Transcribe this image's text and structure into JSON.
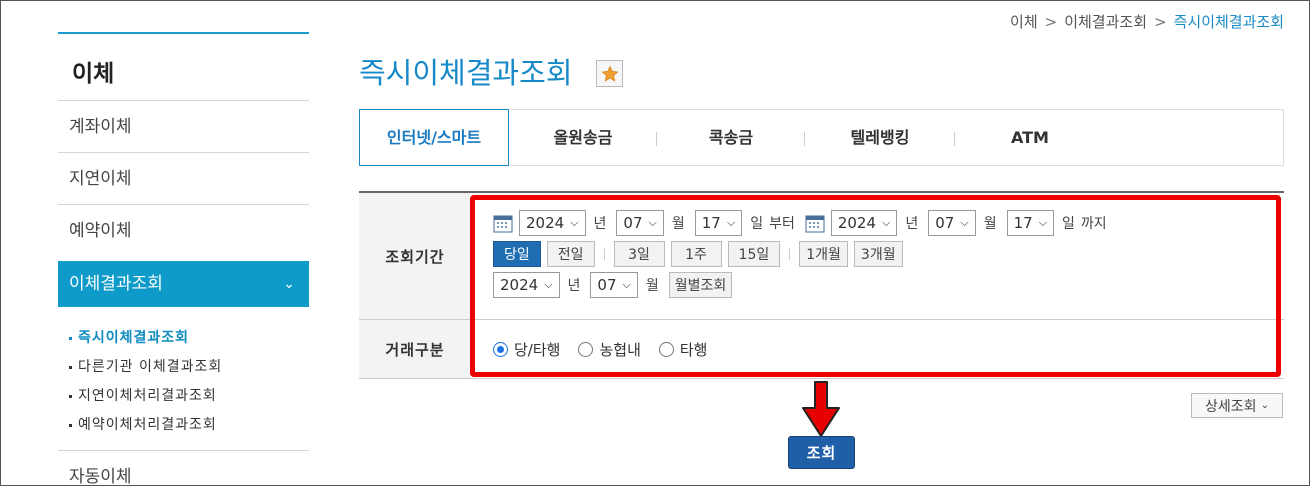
{
  "breadcrumb": [
    "이체",
    "이체결과조회",
    "즉시이체결과조회"
  ],
  "breadcrumb_sep": ">",
  "sidebar": {
    "title": "이체",
    "items": [
      {
        "label": "계좌이체"
      },
      {
        "label": "지연이체"
      },
      {
        "label": "예약이체"
      },
      {
        "label": "이체결과조회",
        "active": true
      }
    ],
    "subitems": [
      {
        "label": "즉시이체결과조회",
        "active": true
      },
      {
        "label": "다른기관 이체결과조회"
      },
      {
        "label": "지연이체처리결과조회"
      },
      {
        "label": "예약이체처리결과조회"
      }
    ],
    "last_item": "자동이체"
  },
  "page_title": "즉시이체결과조회",
  "tabs": [
    {
      "label": "인터넷/스마트",
      "active": true
    },
    {
      "label": "올원송금"
    },
    {
      "label": "콕송금"
    },
    {
      "label": "텔레뱅킹"
    },
    {
      "label": "ATM"
    }
  ],
  "period": {
    "label": "조회기간",
    "from": {
      "year": "2024",
      "month": "07",
      "day": "17"
    },
    "to": {
      "year": "2024",
      "month": "07",
      "day": "17"
    },
    "unit_year": "년",
    "unit_month": "월",
    "unit_day": "일",
    "from_suffix": "부터",
    "to_suffix": "까지",
    "quick_buttons": [
      {
        "label": "당일",
        "active": true
      },
      {
        "label": "전일"
      },
      {
        "label": "3일"
      },
      {
        "label": "1주"
      },
      {
        "label": "15일"
      },
      {
        "label": "1개월"
      },
      {
        "label": "3개월"
      }
    ],
    "monthly": {
      "year": "2024",
      "month": "07",
      "button": "월별조회"
    }
  },
  "tx_type": {
    "label": "거래구분",
    "options": [
      {
        "label": "당/타행",
        "checked": true
      },
      {
        "label": "농협내"
      },
      {
        "label": "타행"
      }
    ]
  },
  "detail_button": "상세조회",
  "search_button": "조회",
  "colors": {
    "accent": "#1689c8",
    "sidebar_active": "#0e9bc9",
    "primary_button": "#1f5fa8",
    "highlight": "#ee0000"
  }
}
